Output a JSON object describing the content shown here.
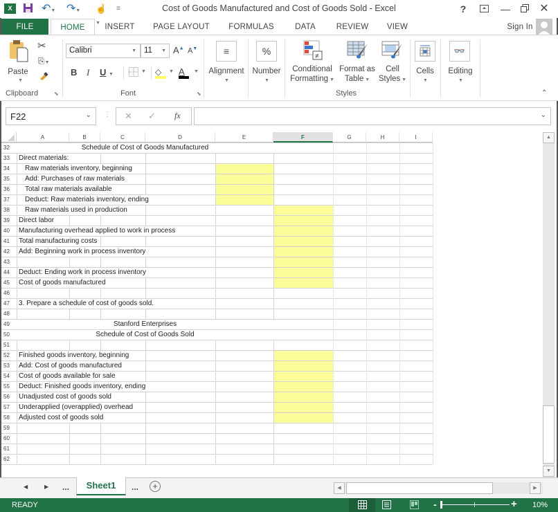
{
  "window": {
    "title": "Cost of Goods Manufactured and Cost of Goods Sold - Excel",
    "help_label": "?",
    "controls": [
      "ribbon-display-options",
      "minimize",
      "restore",
      "close"
    ]
  },
  "quick_access": {
    "icons": [
      "excel-logo-icon",
      "save-icon",
      "undo-icon",
      "redo-icon",
      "touch-mode-icon",
      "customize-qat-icon"
    ]
  },
  "tabs": [
    {
      "label": "FILE"
    },
    {
      "label": "HOME",
      "active": true
    },
    {
      "label": "INSERT"
    },
    {
      "label": "PAGE LAYOUT"
    },
    {
      "label": "FORMULAS"
    },
    {
      "label": "DATA"
    },
    {
      "label": "REVIEW"
    },
    {
      "label": "VIEW"
    }
  ],
  "account": {
    "sign_in_label": "Sign In"
  },
  "ribbon": {
    "clipboard": {
      "paste_label": "Paste",
      "group_label": "Clipboard"
    },
    "font": {
      "font_name": "Calibri",
      "font_size": "11",
      "bold": "B",
      "italic": "I",
      "underline": "U",
      "group_label": "Font",
      "fill_color": "#ffff66",
      "font_color": "#000000"
    },
    "alignment": {
      "label": "Alignment"
    },
    "number": {
      "label": "Number",
      "icon_text": "%"
    },
    "styles": {
      "conditional_formatting": [
        "Conditional",
        "Formatting"
      ],
      "format_as_table": [
        "Format as",
        "Table"
      ],
      "cell_styles": [
        "Cell",
        "Styles"
      ],
      "group_label": "Styles"
    },
    "cells": {
      "label": "Cells"
    },
    "editing": {
      "label": "Editing"
    }
  },
  "formula_bar": {
    "name_box": "F22",
    "cancel_symbol": "✕",
    "enter_symbol": "✓",
    "fx_label": "fx",
    "formula_value": ""
  },
  "sheet": {
    "columns": [
      "A",
      "B",
      "C",
      "D",
      "E",
      "F",
      "G",
      "H",
      "I"
    ],
    "selected_column": "F",
    "rows": [
      {
        "num": "32",
        "text": "Schedule of Cost of Goods Manufactured",
        "align": "center"
      },
      {
        "num": "33",
        "text": "Direct materials:"
      },
      {
        "num": "34",
        "text": "Raw materials inventory, beginning",
        "indent": true
      },
      {
        "num": "35",
        "text": "Add: Purchases of raw materials",
        "indent": true
      },
      {
        "num": "36",
        "text": "Total raw materials available",
        "indent": true
      },
      {
        "num": "37",
        "text": "Deduct: Raw materials inventory, ending",
        "indent": true
      },
      {
        "num": "38",
        "text": "Raw materials used in production",
        "indent": true
      },
      {
        "num": "39",
        "text": "Direct labor"
      },
      {
        "num": "40",
        "text": "Manufacturing overhead applied to work in process"
      },
      {
        "num": "41",
        "text": "Total manufacturing costs"
      },
      {
        "num": "42",
        "text": "Add: Beginning work in process inventory"
      },
      {
        "num": "43",
        "text": ""
      },
      {
        "num": "44",
        "text": "Deduct: Ending work in process inventory"
      },
      {
        "num": "45",
        "text": "Cost of goods manufactured"
      },
      {
        "num": "46",
        "text": ""
      },
      {
        "num": "47",
        "text": "3. Prepare a schedule of cost of goods sold."
      },
      {
        "num": "48",
        "text": ""
      },
      {
        "num": "49",
        "text": "Stanford Enterprises",
        "align": "center"
      },
      {
        "num": "50",
        "text": "Schedule of Cost of Goods Sold",
        "align": "center"
      },
      {
        "num": "51",
        "text": ""
      },
      {
        "num": "52",
        "text": "Finished goods inventory, beginning"
      },
      {
        "num": "53",
        "text": "Add: Cost of goods manufactured"
      },
      {
        "num": "54",
        "text": "Cost of goods available for sale"
      },
      {
        "num": "55",
        "text": "Deduct: Finished goods inventory, ending"
      },
      {
        "num": "56",
        "text": "Unadjusted cost of goods sold"
      },
      {
        "num": "57",
        "text": "Underapplied (overapplied) overhead"
      },
      {
        "num": "58",
        "text": "Adjusted cost of goods sold"
      },
      {
        "num": "59",
        "text": ""
      },
      {
        "num": "60",
        "text": ""
      },
      {
        "num": "61",
        "text": ""
      },
      {
        "num": "62",
        "text": ""
      }
    ],
    "highlighted_ranges": [
      "E34:E37",
      "F38:F45",
      "F52:F58"
    ],
    "highlight_color": "#fbfd99"
  },
  "sheet_tabs": {
    "more_left": "...",
    "active_sheet": "Sheet1",
    "more_right": "...",
    "add_symbol": "+"
  },
  "status_bar": {
    "status": "READY",
    "zoom_level": "10%",
    "zoom_minus": "-",
    "zoom_plus": "+",
    "accent_color": "#217346"
  }
}
